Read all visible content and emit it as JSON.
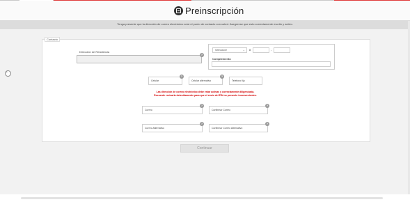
{
  "header": {
    "title": "Preinscripción",
    "notice": "Tenga presente que la dirección de correo electrónico será el punto de contacto con usted. Asegúrese que esto correctamente escrito y activo."
  },
  "section": {
    "legend": "Contacto"
  },
  "address": {
    "label": "Dirección de Residencia",
    "select_value": "Seleccione",
    "hash": "#",
    "dash": "-",
    "complement_label": "Complemento"
  },
  "phones": {
    "cell": "Celular",
    "cell_alt": "Celular alternativo",
    "landline": "Telefono fijo"
  },
  "warning": {
    "line1": "Las dirección de correo electrónico debe estar activas y correctamente diligenciada.",
    "line2": "Recuerde revisarla detenidamente para que el envío del PIN no presente inconvenientes."
  },
  "emails": {
    "email": "Correo",
    "confirm_email": "Confirmar Correo",
    "alt_email": "Correo Alternativo",
    "confirm_alt_email": "Confirmar Correo Alternativo"
  },
  "help_glyph": "?",
  "back_glyph": "‹",
  "button": {
    "continue": "Continuar"
  }
}
